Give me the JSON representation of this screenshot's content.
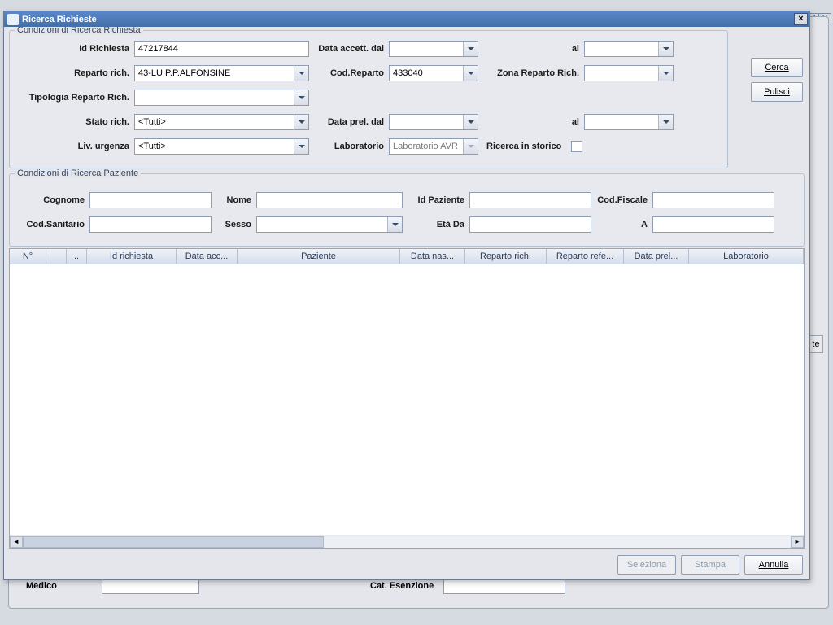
{
  "window": {
    "title": "Ricerca Richieste"
  },
  "background": {
    "medico_label": "Medico",
    "cat_label": "Cat. Esenzione",
    "partial_btn": "te"
  },
  "richiesta": {
    "legend": "Condizioni di Ricerca Richiesta",
    "id_label": "Id Richiesta",
    "id_value": "47217844",
    "data_accett_label": "Data accett. dal",
    "al_label": "al",
    "reparto_label": "Reparto rich.",
    "reparto_value": "43-LU P.P.ALFONSINE",
    "cod_reparto_label": "Cod.Reparto",
    "cod_reparto_value": "433040",
    "zona_label": "Zona Reparto Rich.",
    "tipologia_label": "Tipologia Reparto Rich.",
    "stato_label": "Stato rich.",
    "stato_value": "<Tutti>",
    "data_prel_label": "Data prel. dal",
    "urgenza_label": "Liv. urgenza",
    "urgenza_value": "<Tutti>",
    "laboratorio_label": "Laboratorio",
    "laboratorio_value": "Laboratorio AVR",
    "storico_label": "Ricerca in storico"
  },
  "paziente": {
    "legend": "Condizioni di Ricerca Paziente",
    "cognome_label": "Cognome",
    "nome_label": "Nome",
    "id_paziente_label": "Id Paziente",
    "cod_fiscale_label": "Cod.Fiscale",
    "cod_sanitario_label": "Cod.Sanitario",
    "sesso_label": "Sesso",
    "eta_da_label": "Età Da",
    "a_label": "A"
  },
  "buttons": {
    "cerca": "Cerca",
    "pulisci": "Pulisci",
    "seleziona": "Seleziona",
    "stampa": "Stampa",
    "annulla": "Annulla"
  },
  "grid": {
    "columns": [
      "N°",
      "",
      "..",
      "Id richiesta",
      "Data acc...",
      "Paziente",
      "Data nas...",
      "Reparto rich.",
      "Reparto refe...",
      "Data prel...",
      "Laboratorio"
    ]
  }
}
